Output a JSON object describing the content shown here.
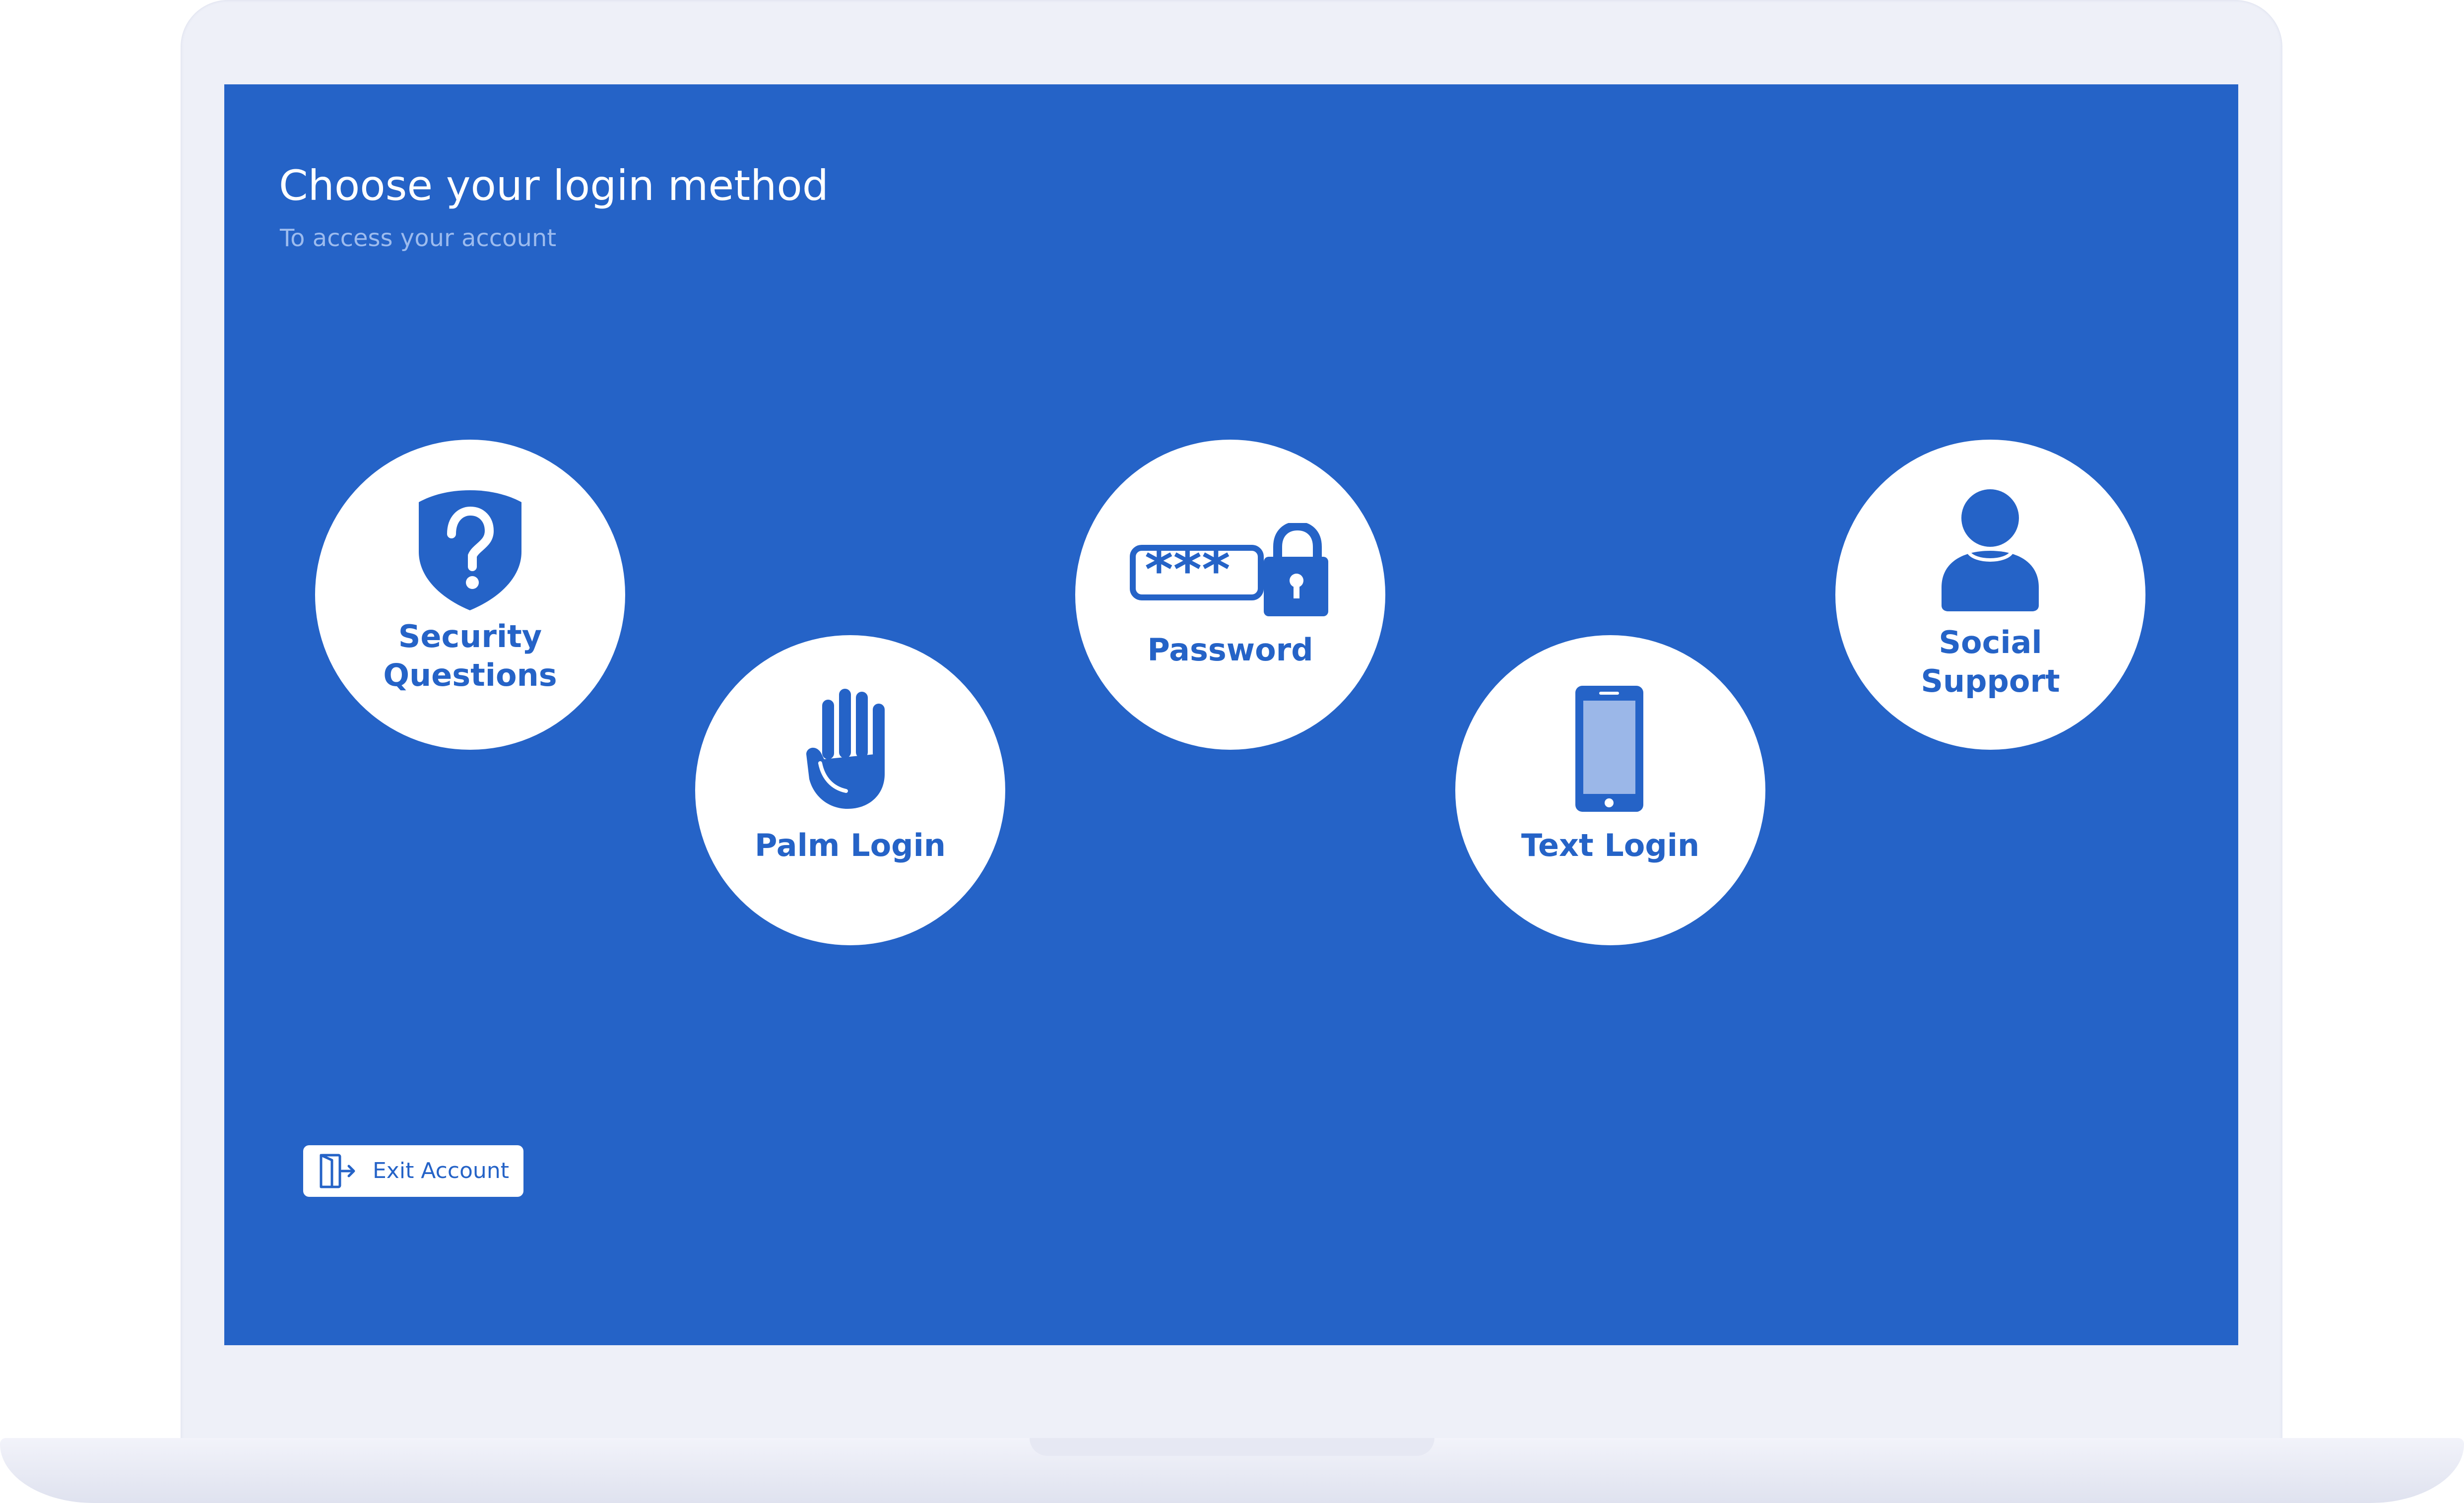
{
  "header": {
    "title": "Choose your login method",
    "subtitle": "To access your account"
  },
  "login_options": [
    {
      "label": "Security\nQuestions",
      "icon": "shield-question-icon"
    },
    {
      "label": "Palm Login",
      "icon": "palm-hand-icon"
    },
    {
      "label": "Password",
      "icon": "password-lock-icon"
    },
    {
      "label": "Text Login",
      "icon": "mobile-phone-icon"
    },
    {
      "label": "Social\nSupport",
      "icon": "person-icon"
    }
  ],
  "exit_button": {
    "label": "Exit Account",
    "icon": "exit-door-icon"
  },
  "colors": {
    "screen_background": "#2563c7",
    "accent": "#2563c7",
    "subtitle": "#9cbbee",
    "option_background": "#ffffff",
    "device_frame": "#eef0f8"
  }
}
